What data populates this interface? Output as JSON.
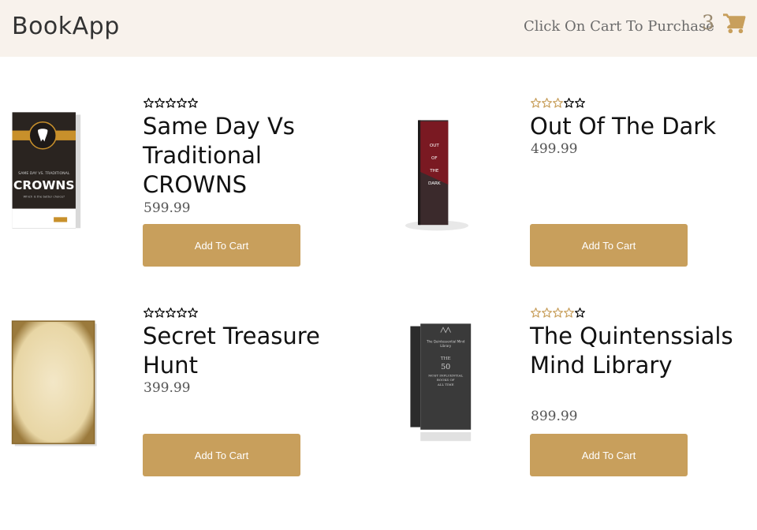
{
  "app": {
    "title": "BookApp"
  },
  "header": {
    "hint": "Click On Cart To Purchase",
    "cart_count": "3",
    "cart_icon": "shopping-cart-icon"
  },
  "colors": {
    "header_bg": "#f8f2ec",
    "accent": "#c89f5c",
    "star": "#c89f5c"
  },
  "books": [
    {
      "title": "Same Day Vs Traditional CROWNS",
      "price": "599.99",
      "rating": 0,
      "button_label": "Add To Cart",
      "cover": {
        "line1": "SAME DAY VS. TRADITIONAL",
        "line2": "CROWNS",
        "line3": "Which is the better choice?"
      }
    },
    {
      "title": "Out Of The Dark",
      "price": "499.99",
      "rating": 3,
      "button_label": "Add To Cart",
      "cover": {
        "line1": "OUT",
        "line2": "OF",
        "line3": "THE",
        "line4": "DARK"
      }
    },
    {
      "title": "Secret Treasure Hunt",
      "price": "399.99",
      "rating": 0,
      "button_label": "Add To Cart",
      "cover": {}
    },
    {
      "title": "The Quintenssials Mind Library",
      "price": "899.99",
      "rating": 4,
      "button_label": "Add To Cart",
      "cover": {
        "line1": "The Quintessential Mind",
        "line2": "Library",
        "line3": "THE",
        "line4": "50",
        "line5": "MOST INFLUENTIAL",
        "line6": "BOOKS OF",
        "line7": "ALL TIME"
      }
    }
  ]
}
